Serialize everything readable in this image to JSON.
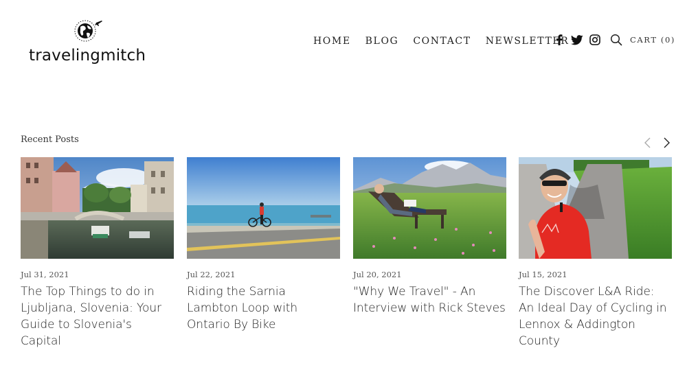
{
  "site": {
    "logo_text": "travelingmitch",
    "logo_icon": "globe-airplane-icon"
  },
  "nav": {
    "items": [
      {
        "label": "HOME"
      },
      {
        "label": "BLOG"
      },
      {
        "label": "CONTACT"
      },
      {
        "label": "NEWSLETTER"
      }
    ]
  },
  "social": [
    "facebook-icon",
    "twitter-icon",
    "instagram-icon"
  ],
  "cart": {
    "label": "CART (0)"
  },
  "recent": {
    "title": "Recent Posts",
    "posts": [
      {
        "date": "Jul 31, 2021",
        "title": "The Top Things to do in Ljubljana, Slovenia: Your Guide to Slovenia's Capital",
        "image": "ljubljana-canal-photo"
      },
      {
        "date": "Jul 22, 2021",
        "title": "Riding the Sarnia Lambton Loop with Ontario By Bike",
        "image": "lakeshore-cyclist-photo"
      },
      {
        "date": "Jul 20, 2021",
        "title": "\"Why We Travel\" - An Interview with Rick Steves",
        "image": "meadow-lounger-photo"
      },
      {
        "date": "Jul 15, 2021",
        "title": "The Discover L&A Ride: An Ideal Day of Cycling in Lennox & Addington County",
        "image": "cyclist-selfie-photo"
      }
    ]
  }
}
